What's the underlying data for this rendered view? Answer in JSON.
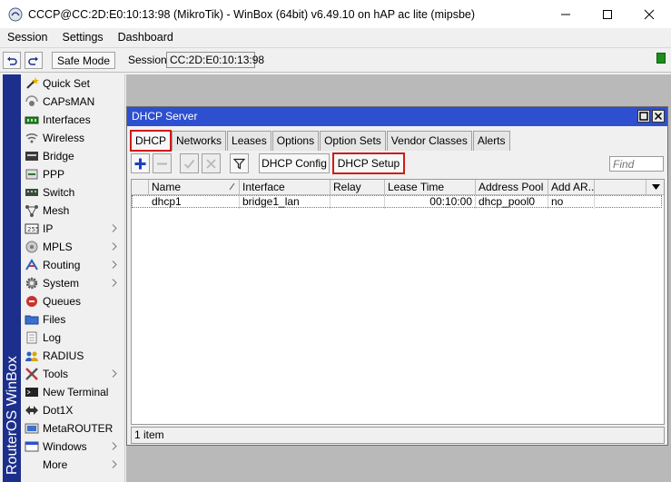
{
  "window": {
    "title": "CCCP@CC:2D:E0:10:13:98 (MikroTik) - WinBox (64bit) v6.49.10 on hAP ac lite (mipsbe)"
  },
  "menubar": {
    "items": [
      "Session",
      "Settings",
      "Dashboard"
    ]
  },
  "toolbar": {
    "safe_mode_label": "Safe Mode",
    "session_label": "Session:",
    "session_value": "CC:2D:E0:10:13:98",
    "status_color": "#1e8c1e"
  },
  "brand": {
    "text": "RouterOS WinBox",
    "color": "#1c2f8c"
  },
  "sidebar": {
    "items": [
      {
        "label": "Quick Set",
        "icon": "wand-icon",
        "submenu": false
      },
      {
        "label": "CAPsMAN",
        "icon": "capsman-icon",
        "submenu": false
      },
      {
        "label": "Interfaces",
        "icon": "interfaces-icon",
        "submenu": false
      },
      {
        "label": "Wireless",
        "icon": "wireless-icon",
        "submenu": false
      },
      {
        "label": "Bridge",
        "icon": "bridge-icon",
        "submenu": false
      },
      {
        "label": "PPP",
        "icon": "ppp-icon",
        "submenu": false
      },
      {
        "label": "Switch",
        "icon": "switch-icon",
        "submenu": false
      },
      {
        "label": "Mesh",
        "icon": "mesh-icon",
        "submenu": false
      },
      {
        "label": "IP",
        "icon": "ip-icon",
        "submenu": true
      },
      {
        "label": "MPLS",
        "icon": "mpls-icon",
        "submenu": true
      },
      {
        "label": "Routing",
        "icon": "routing-icon",
        "submenu": true
      },
      {
        "label": "System",
        "icon": "system-icon",
        "submenu": true
      },
      {
        "label": "Queues",
        "icon": "queues-icon",
        "submenu": false
      },
      {
        "label": "Files",
        "icon": "files-icon",
        "submenu": false
      },
      {
        "label": "Log",
        "icon": "log-icon",
        "submenu": false
      },
      {
        "label": "RADIUS",
        "icon": "radius-icon",
        "submenu": false
      },
      {
        "label": "Tools",
        "icon": "tools-icon",
        "submenu": true
      },
      {
        "label": "New Terminal",
        "icon": "terminal-icon",
        "submenu": false
      },
      {
        "label": "Dot1X",
        "icon": "dot1x-icon",
        "submenu": false
      },
      {
        "label": "MetaROUTER",
        "icon": "metarouter-icon",
        "submenu": false
      },
      {
        "label": "Windows",
        "icon": "windows-icon",
        "submenu": true
      },
      {
        "label": "More",
        "icon": "",
        "submenu": true
      }
    ]
  },
  "dhcp_window": {
    "title": "DHCP Server",
    "tabs": [
      "DHCP",
      "Networks",
      "Leases",
      "Options",
      "Option Sets",
      "Vendor Classes",
      "Alerts"
    ],
    "active_tab": "DHCP",
    "buttons": {
      "config": "DHCP Config",
      "setup": "DHCP Setup"
    },
    "find_placeholder": "Find",
    "highlight_color": "#d11a1a",
    "table": {
      "columns": [
        "Name",
        "Interface",
        "Relay",
        "Lease Time",
        "Address Pool",
        "Add AR..."
      ],
      "rows": [
        [
          "dhcp1",
          "bridge1_lan",
          "",
          "00:10:00",
          "dhcp_pool0",
          "no"
        ]
      ]
    },
    "status": "1 item"
  }
}
